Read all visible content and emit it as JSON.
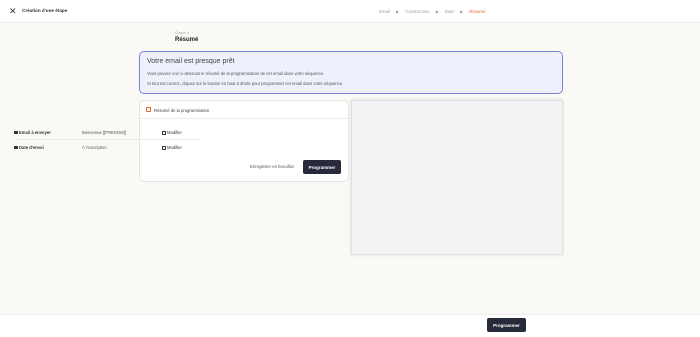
{
  "header": {
    "title": "Création d'une étape",
    "steps": [
      "Email",
      "Construction",
      "Date",
      "Résumé"
    ],
    "active_step": "Résumé"
  },
  "page": {
    "breadcrumb": "Étape 4",
    "title": "Résumé"
  },
  "notice": {
    "title": "Votre email est presque prêt",
    "line1": "Vous pouvez voir ci-dessous le résumé de la programmation de cet email dans votre séquence.",
    "line2": "Si tout est correct, cliquez sur le bouton en haut à droite pour programmer cet email dans votre séquence."
  },
  "summary": {
    "title": "Résumé de la programmation",
    "rows": [
      {
        "label": "Email à envoyer",
        "value": "Bienvenue [[PRENOM]]",
        "action": "Modifier",
        "icon": "envelope-icon"
      },
      {
        "label": "Date d'envoi",
        "value": "À l'inscription",
        "action": "Modifier",
        "icon": "calendar-icon"
      }
    ],
    "draft_label": "Enregistrer en brouillon",
    "program_label": "Programmer"
  },
  "footer": {
    "program_label": "Programmer"
  },
  "colors": {
    "accent": "#e5632e",
    "notice_bg": "#eef0fc",
    "notice_border": "#7b82d6",
    "button_dark": "#272a3b"
  }
}
